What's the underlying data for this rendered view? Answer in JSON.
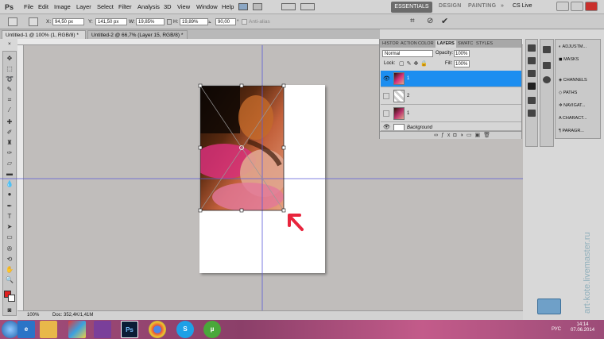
{
  "app": {
    "logo": "Ps"
  },
  "menu": [
    "File",
    "Edit",
    "Image",
    "Layer",
    "Select",
    "Filter",
    "Analysis",
    "3D",
    "View",
    "Window",
    "Help"
  ],
  "workspaces": {
    "active": "ESSENTIALS",
    "items": [
      "DESIGN",
      "PAINTING"
    ],
    "more": "»",
    "cslive": "CS Live"
  },
  "options": {
    "x_label": "X:",
    "x_value": "94,50 px",
    "y_label": "Y:",
    "y_value": "141,50 px",
    "w_label": "W:",
    "w_value": "19,85%",
    "h_label": "H:",
    "h_value": "19,89%",
    "angle_value": "90,00",
    "angle_unit": "°",
    "antialias": "Anti-alias"
  },
  "tabs": [
    {
      "label": "Untitled-1 @ 100% (1, RGB/8) *",
      "close": "×"
    },
    {
      "label": "Untitled-2 @ 66,7% (Layer 15, RGB/8) *",
      "close": "×"
    }
  ],
  "status": {
    "zoom": "100%",
    "doc": "Doc: 352,4K/1,41M"
  },
  "layers_panel": {
    "tabs": [
      "HISTOR",
      "ACTION",
      "COLOR",
      "LAYERS",
      "SWATC",
      "STYLES"
    ],
    "active_tab": "LAYERS",
    "blend_mode": "Normal",
    "opacity_label": "Opacity:",
    "opacity_value": "100%",
    "lock_label": "Lock:",
    "fill_label": "Fill:",
    "fill_value": "100%",
    "layers": [
      {
        "name": "1",
        "selected": true,
        "visible": true
      },
      {
        "name": "2",
        "selected": false,
        "visible": false
      },
      {
        "name": "1",
        "selected": false,
        "visible": false
      },
      {
        "name": "Background",
        "selected": false,
        "visible": true
      }
    ]
  },
  "side_panels": [
    "ADJUSTM...",
    "MASKS",
    "CHANNELS",
    "PATHS",
    "NAVIGAT...",
    "CHARACT...",
    "PARAGR..."
  ],
  "taskbar": {
    "time": "14:14",
    "date": "07.06.2014",
    "lang": "РУС",
    "apps": [
      "ie-icon",
      "explorer-icon",
      "app-icon",
      "app2-icon",
      "photoshop-icon",
      "chrome-icon",
      "skype-icon",
      "utorrent-icon"
    ],
    "ps_label": "Ps"
  },
  "watermark": "art-kote.livemaster.ru",
  "colors": {
    "accent": "#1c8ef0",
    "arrow": "#e8243c",
    "taskbar": "#9c4c78"
  }
}
